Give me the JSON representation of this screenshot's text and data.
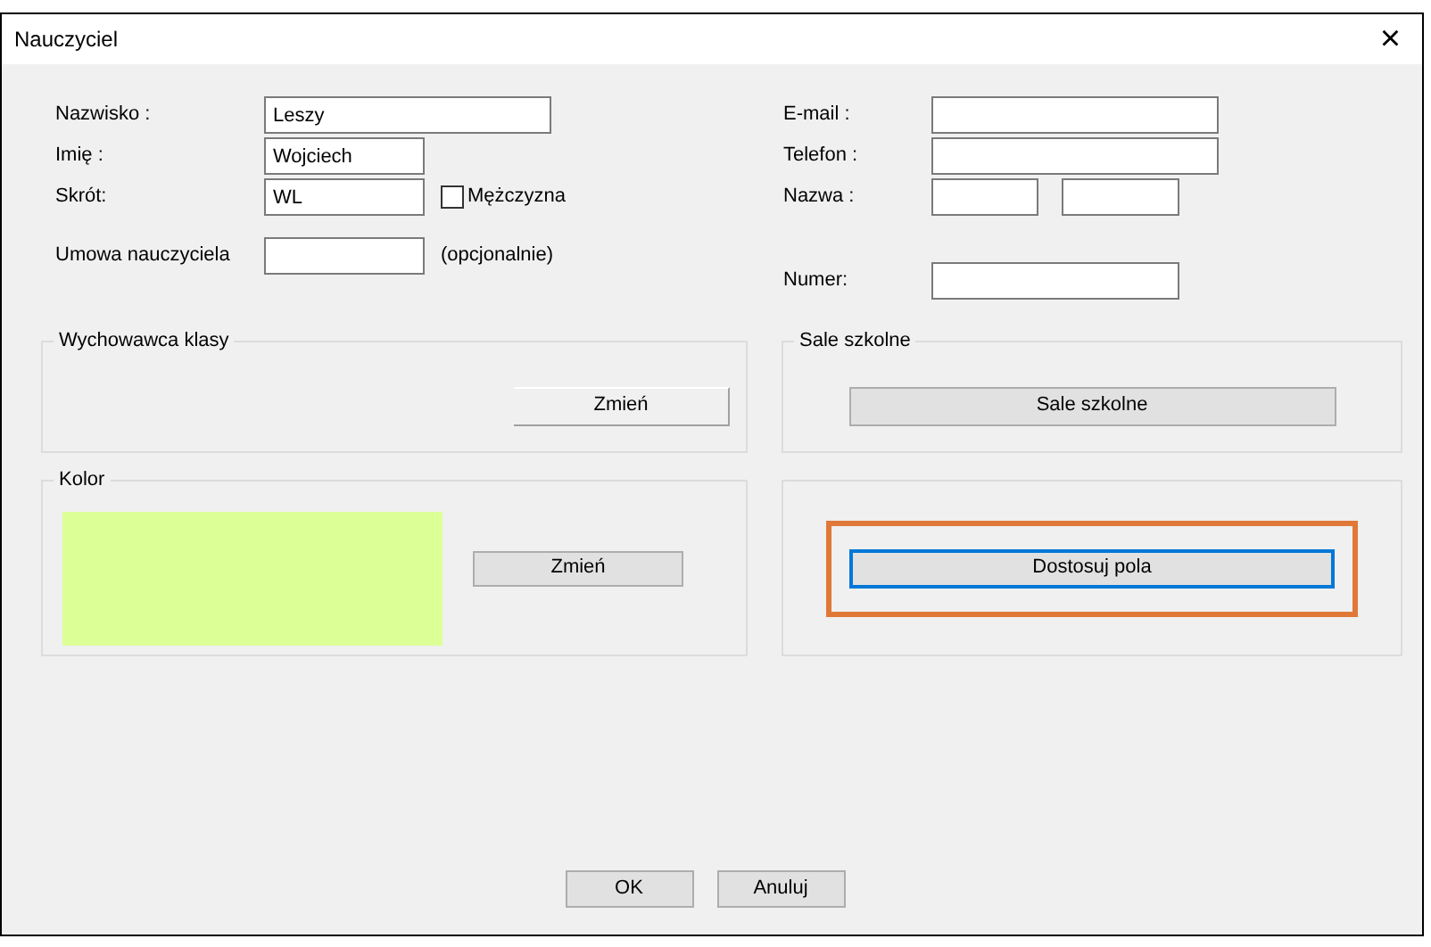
{
  "window": {
    "title": "Nauczyciel",
    "close": "×"
  },
  "left_fields": [
    {
      "kind": "text",
      "label": "Nazwisko :",
      "value": "Leszy"
    },
    {
      "kind": "text",
      "label": "Imię :",
      "value": "Wojciech"
    },
    {
      "kind": "text_check",
      "label": "Skrót:",
      "value": "WL",
      "checkbox": {
        "label": "Mężczyzna",
        "checked": false
      }
    },
    {
      "kind": "text_hint",
      "label": "Umowa nauczyciela",
      "hint": "(opcjonalnie)"
    }
  ],
  "right_fields": [
    {
      "kind": "text",
      "label": "E-mail :"
    },
    {
      "kind": "text",
      "label": "Telefon :"
    },
    {
      "kind": "pair",
      "label": "Nazwa :"
    },
    {
      "kind": "text",
      "label": "Numer:"
    }
  ],
  "groups": [
    {
      "kind": "button",
      "title": "Wychowawca klasy",
      "button": "Zmień"
    },
    {
      "kind": "button",
      "title": "Sale szkolne",
      "button": "Sale szkolne"
    },
    {
      "kind": "color",
      "title": "Kolor",
      "color": "#dcff96",
      "button": "Zmień"
    },
    {
      "kind": "button",
      "button": "Dostosuj pola",
      "highlighted": true
    }
  ],
  "buttons": [
    "OK",
    "Anuluj"
  ]
}
